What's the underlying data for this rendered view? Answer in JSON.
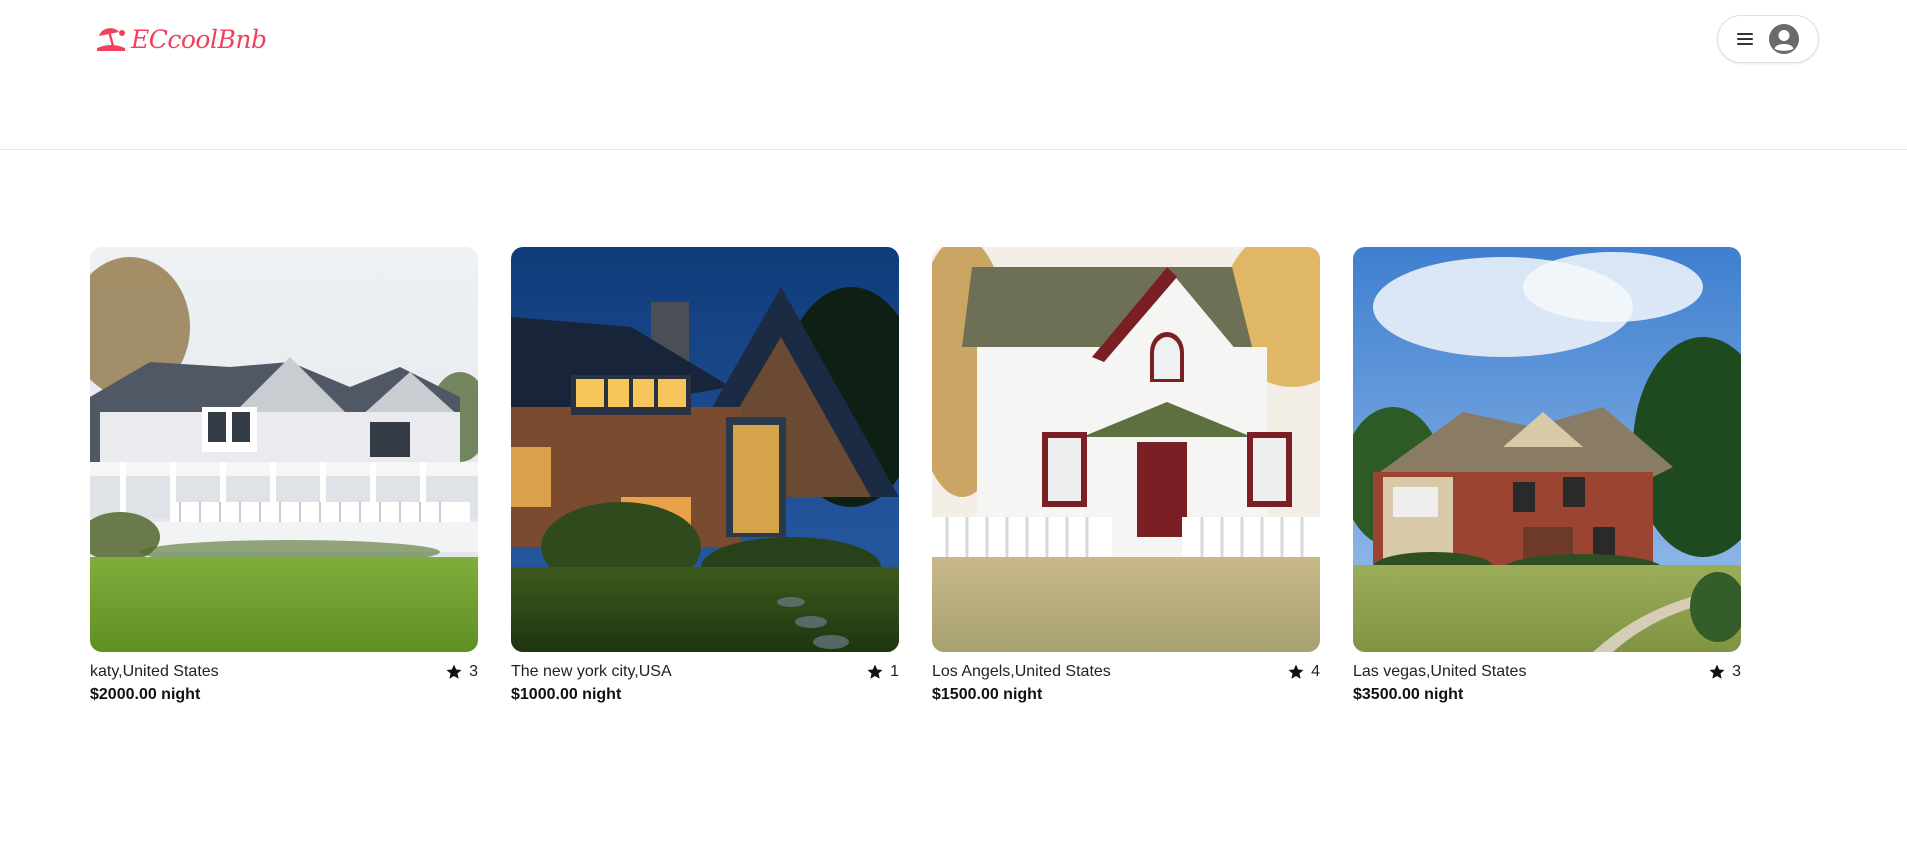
{
  "header": {
    "brand": "ECcoolBnb",
    "brand_icon": "umbrella-beach-icon",
    "menu_icon": "hamburger-menu-icon",
    "avatar_icon": "user-circle-icon",
    "brand_color": "#f0415c"
  },
  "listings": [
    {
      "location": "katy,United States",
      "rating": "3",
      "price": "$2000.00 night"
    },
    {
      "location": "The new york city,USA",
      "rating": "1",
      "price": "$1000.00 night"
    },
    {
      "location": "Los Angels,United States",
      "rating": "4",
      "price": "$1500.00 night"
    },
    {
      "location": "Las vegas,United States",
      "rating": "3",
      "price": "$3500.00 night"
    }
  ]
}
